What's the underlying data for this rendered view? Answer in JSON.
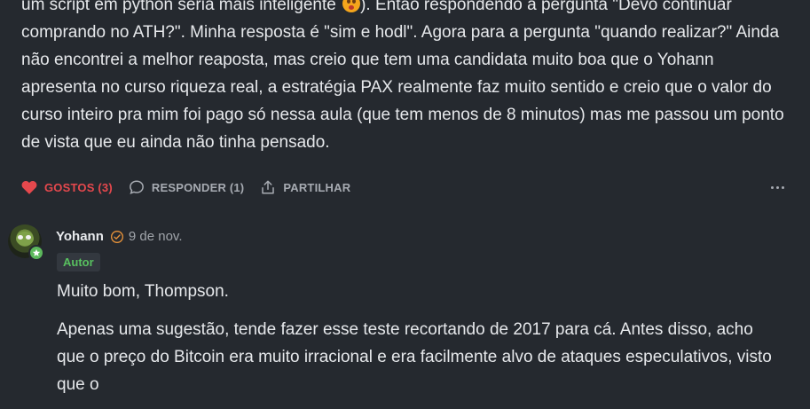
{
  "comment": {
    "line1_a": "um script em python seria mais inteligente",
    "line1_b": "). Então respondendo a pergunta \"Devo continuar comprando no ATH?\". Minha resposta é \"sim e hodl\". Agora para a pergunta \"quando realizar?\" Ainda não encontrei a melhor reaposta, mas creio que tem uma candidata muito boa que o Yohann apresenta no curso riqueza real, a estratégia PAX realmente faz muito sentido e creio que o valor do curso inteiro pra mim foi pago só nessa aula (que tem menos de 8 minutos) mas me passou um ponto de vista que eu ainda não tinha pensado.",
    "emoji": "flushed-face-emoji"
  },
  "actions": {
    "like_label": "GOSTOS (3)",
    "reply_label": "RESPONDER (1)",
    "share_label": "PARTILHAR",
    "like_color": "#e5484d"
  },
  "reply": {
    "author": "Yohann",
    "date": "9 de nov.",
    "role": "Autor",
    "role_color": "#58c05f",
    "paragraph1": "Muito bom, Thompson.",
    "paragraph2": "Apenas uma sugestão, tende fazer esse teste recortando de 2017 para cá. Antes disso, acho que o preço do Bitcoin era muito irracional e era facilmente alvo de ataques especulativos, visto que o"
  }
}
